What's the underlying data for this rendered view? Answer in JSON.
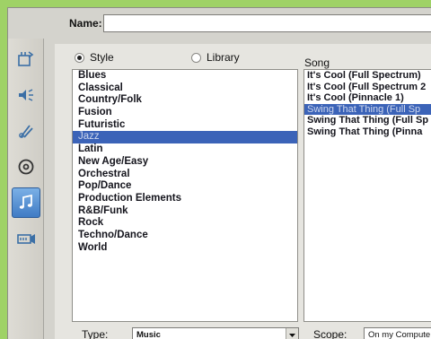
{
  "name_field": {
    "label": "Name:",
    "value": ""
  },
  "sidebar": {
    "items": [
      {
        "icon": "video-clip-icon"
      },
      {
        "icon": "audio-speaker-icon"
      },
      {
        "icon": "edit-tools-icon"
      },
      {
        "icon": "disc-icon"
      },
      {
        "icon": "music-note-icon",
        "active": true
      },
      {
        "icon": "volume-mixer-icon"
      }
    ]
  },
  "source_radio": {
    "style_label": "Style",
    "library_label": "Library",
    "selected": "Style"
  },
  "genres": [
    "Blues",
    "Classical",
    "Country/Folk",
    "Fusion",
    "Futuristic",
    "Jazz",
    "Latin",
    "New Age/Easy",
    "Orchestral",
    "Pop/Dance",
    "Production Elements",
    "R&B/Funk",
    "Rock",
    "Techno/Dance",
    "World"
  ],
  "selected_genre": "Jazz",
  "songs": {
    "header": "Song",
    "items": [
      "It's Cool (Full Spectrum)",
      "It's Cool (Full Spectrum 2",
      "It's Cool (Pinnacle 1)",
      "Swing That Thing (Full Sp",
      "Swing That Thing (Full Sp",
      "Swing That Thing (Pinna"
    ],
    "selected_index": 3
  },
  "type": {
    "label": "Type:",
    "value": "Music"
  },
  "scope": {
    "label": "Scope:",
    "value": "On my Compute"
  },
  "colors": {
    "selection": "#3b63b8",
    "background": "#9fd266"
  }
}
